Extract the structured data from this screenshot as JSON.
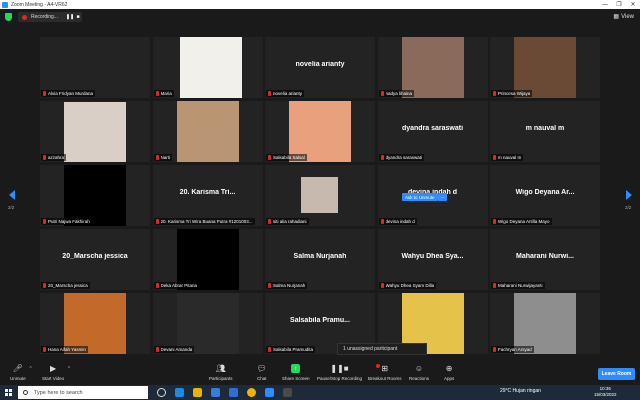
{
  "window": {
    "title": "Zoom Meeting - A4-VR62",
    "controls": [
      "—",
      "❐",
      "✕"
    ]
  },
  "recording": {
    "label": "Recording...",
    "pause_icon": "pause-icon",
    "stop_icon": "stop-icon",
    "view_label": "View"
  },
  "colors": {
    "accent": "#2d8cff",
    "recording": "#e02828",
    "share": "#23d959",
    "tile_bg": "#232323"
  },
  "tiles": [
    {
      "name": "Alvia Fridyan Murdana",
      "display": "",
      "kind": "blank"
    },
    {
      "name": "Maria",
      "display": "",
      "kind": "photo-light"
    },
    {
      "name": "novelia arianty",
      "display": "novelia arianty",
      "kind": "text"
    },
    {
      "name": "nadya lihaina",
      "display": "",
      "kind": "photo"
    },
    {
      "name": "Princesa Wijaya",
      "display": "",
      "kind": "photo"
    },
    {
      "name": "azzahra",
      "display": "",
      "kind": "photo"
    },
    {
      "name": "Narti",
      "display": "",
      "kind": "photo"
    },
    {
      "name": "Salsabila Salsal",
      "display": "",
      "kind": "photo"
    },
    {
      "name": "dyandra saraswati",
      "display": "dyandra saraswati",
      "kind": "text"
    },
    {
      "name": "m nauval m",
      "display": "m nauval m",
      "kind": "text"
    },
    {
      "name": "Putri Najwa Fakhirah",
      "display": "",
      "kind": "photo-dark"
    },
    {
      "name": "20. Karisma Tri Wira Buana Putra #1201003...",
      "display": "20. Karisma Tri...",
      "kind": "text"
    },
    {
      "name": "siti alia rahadiani",
      "display": "",
      "kind": "photo"
    },
    {
      "name": "devina indah d",
      "display": "devina indah d",
      "kind": "text"
    },
    {
      "name": "Wigo Deyana Artilla Mayo",
      "display": "Wigo Deyana Ar...",
      "kind": "text"
    },
    {
      "name": "20_Marscha jessica",
      "display": "20_Marscha jessica",
      "kind": "text"
    },
    {
      "name": "Deka Abrar Pitana",
      "display": "",
      "kind": "photo-dark"
    },
    {
      "name": "Salma Nurjanah",
      "display": "Salma Nurjanah",
      "kind": "text"
    },
    {
      "name": "Wahyu Dhea Syam Dilla",
      "display": "Wahyu Dhea Sya...",
      "kind": "text"
    },
    {
      "name": "Maharani Nurwijayanti",
      "display": "Maharani Nurwi...",
      "kind": "text"
    },
    {
      "name": "Hana Aifah Yasmin",
      "display": "",
      "kind": "photo"
    },
    {
      "name": "Devani Amanda",
      "display": "",
      "kind": "photo"
    },
    {
      "name": "Salsabila Pramudita",
      "display": "Salsabila Pramu...",
      "kind": "text"
    },
    {
      "name": "",
      "display": "",
      "kind": "photo"
    },
    {
      "name": "Fachryan Arsyad",
      "display": "",
      "kind": "photo"
    }
  ],
  "ask_to_unmute": {
    "label": "Ask to Unmute",
    "more": "..."
  },
  "pagination": {
    "left": "2/2",
    "right": "2/2"
  },
  "unassigned": "1 unassigned participant",
  "toolbar": {
    "unmute": "Unmute",
    "start_video": "Start Video",
    "participants": "Participants",
    "participants_count": "36",
    "chat": "Chat",
    "share_screen": "Share Screen",
    "record": "Pause/Stop Recording",
    "breakout": "Breakout Rooms",
    "reactions": "Reactions",
    "apps": "Apps",
    "leave": "Leave Room"
  },
  "taskbar": {
    "search_placeholder": "Type here to search",
    "weather": "29°C  Hujan ringan",
    "time": "10:36",
    "date": "15/03/2022"
  }
}
